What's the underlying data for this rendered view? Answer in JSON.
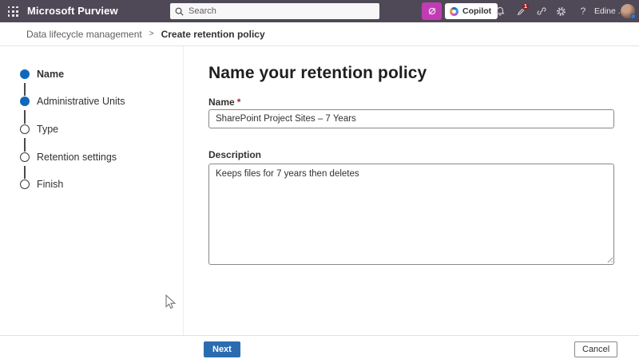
{
  "topbar": {
    "app_title": "Microsoft Purview",
    "search": {
      "placeholder": "Search"
    },
    "copilot_button": {
      "label": "Copilot"
    },
    "notifications": {
      "badge_count": "1"
    },
    "help_glyph": "?",
    "user": {
      "display_name": "Edine ."
    }
  },
  "breadcrumb": {
    "separator": ">",
    "items": [
      {
        "label": "Data lifecycle management"
      },
      {
        "label": "Create retention policy"
      }
    ]
  },
  "wizard": {
    "steps": [
      {
        "label": "Name",
        "state": "current"
      },
      {
        "label": "Administrative Units",
        "state": "completed"
      },
      {
        "label": "Type",
        "state": "upcoming"
      },
      {
        "label": "Retention settings",
        "state": "upcoming"
      },
      {
        "label": "Finish",
        "state": "upcoming"
      }
    ]
  },
  "main": {
    "heading": "Name your retention policy",
    "name_field": {
      "label": "Name",
      "required_marker": "*",
      "value": "SharePoint Project Sites – 7 Years"
    },
    "description_field": {
      "label": "Description",
      "value": "Keeps files for 7 years then deletes"
    }
  },
  "footer": {
    "next_label": "Next",
    "cancel_label": "Cancel"
  },
  "icons": {
    "app-launcher-icon": "waffle-grid",
    "search-icon": "magnifier",
    "copilot-promo-icon": "swirl-on-magenta-tile",
    "copilot-icon": "multicolor-ring",
    "bell-icon": "notification-bell",
    "pen-icon": "whats-new-pen",
    "link-icon": "chain-link",
    "gear-icon": "settings-gear",
    "help-icon": "question-mark",
    "presence-badge": "blue-dot",
    "mouse-cursor": "arrow-pointer"
  },
  "colors": {
    "topbar_bg": "#4f4957",
    "magenta": "#c13cb4",
    "step_blue": "#1168bb",
    "next_button_blue": "#2b6cb0",
    "badge_red": "#8f2024",
    "required_red": "#a4262c"
  }
}
